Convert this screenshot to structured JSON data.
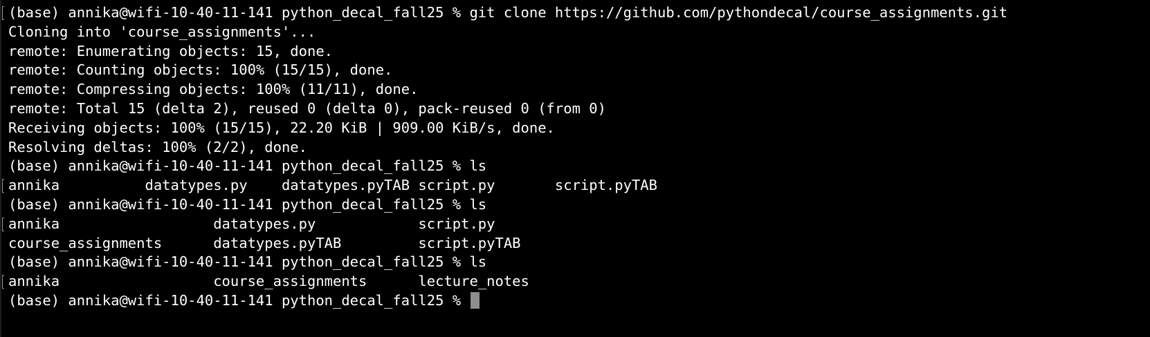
{
  "terminal": {
    "top_partial": "python_decal_fall25",
    "lines": [
      {
        "text": "(base) annika@wifi-10-40-11-141 python_decal_fall25 % git clone https://github.com/pythondecal/course_assignments.git",
        "marked": true
      },
      {
        "text": "Cloning into 'course_assignments'...",
        "marked": false
      },
      {
        "text": "remote: Enumerating objects: 15, done.",
        "marked": false
      },
      {
        "text": "remote: Counting objects: 100% (15/15), done.",
        "marked": false
      },
      {
        "text": "remote: Compressing objects: 100% (11/11), done.",
        "marked": false
      },
      {
        "text": "remote: Total 15 (delta 2), reused 0 (delta 0), pack-reused 0 (from 0)",
        "marked": false
      },
      {
        "text": "Receiving objects: 100% (15/15), 22.20 KiB | 909.00 KiB/s, done.",
        "marked": false
      },
      {
        "text": "Resolving deltas: 100% (2/2), done.",
        "marked": false
      },
      {
        "text": "(base) annika@wifi-10-40-11-141 python_decal_fall25 % ls",
        "marked": false
      },
      {
        "text": "annika          datatypes.py    datatypes.pyTAB script.py       script.pyTAB",
        "marked": true
      },
      {
        "text": "(base) annika@wifi-10-40-11-141 python_decal_fall25 % ls",
        "marked": false
      },
      {
        "text": "annika                  datatypes.py            script.py",
        "marked": true
      },
      {
        "text": "course_assignments      datatypes.pyTAB         script.pyTAB",
        "marked": false
      },
      {
        "text": "(base) annika@wifi-10-40-11-141 python_decal_fall25 % ls",
        "marked": false
      },
      {
        "text": "annika                  course_assignments      lecture_notes",
        "marked": true
      }
    ],
    "prompt": "(base) annika@wifi-10-40-11-141 python_decal_fall25 % "
  }
}
